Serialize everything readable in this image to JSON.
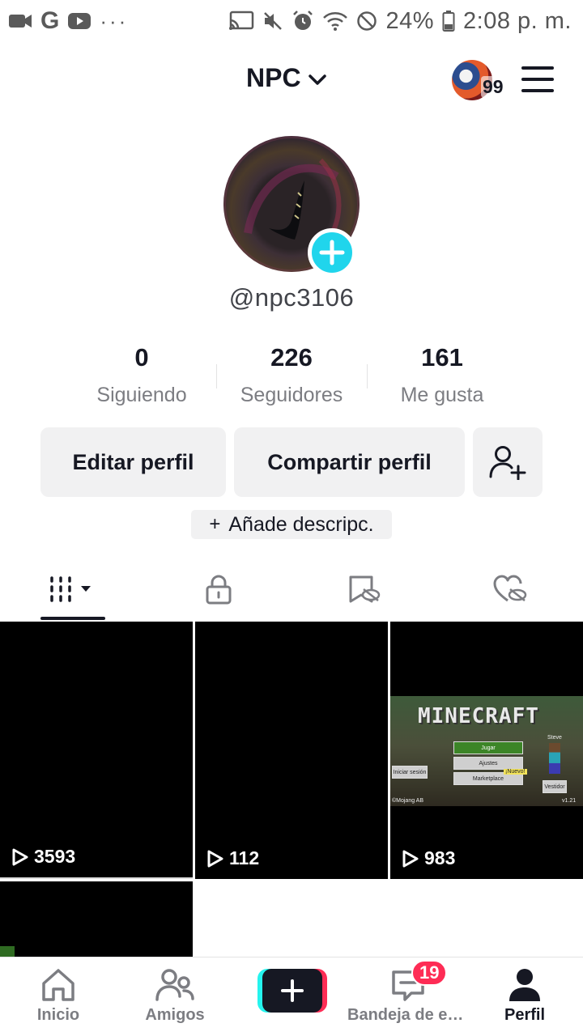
{
  "status_bar": {
    "battery": "24%",
    "time": "2:08 p. m.",
    "left_icons": [
      "video-camera-icon",
      "google-icon",
      "youtube-icon",
      "more-dots-icon"
    ],
    "right_icons": [
      "cast-icon",
      "mute-icon",
      "alarm-icon",
      "wifi-icon",
      "do-not-disturb-icon",
      "battery-icon"
    ]
  },
  "header": {
    "account_name": "NPC",
    "notification_count": "99"
  },
  "profile": {
    "username": "@npc3106",
    "stats": [
      {
        "value": "0",
        "label": "Siguiendo"
      },
      {
        "value": "226",
        "label": "Seguidores"
      },
      {
        "value": "161",
        "label": "Me gusta"
      }
    ],
    "edit_label": "Editar perfil",
    "share_label": "Compartir perfil",
    "add_description_label": "Añade descripc."
  },
  "tabs": [
    {
      "icon": "grid-icon",
      "active": true
    },
    {
      "icon": "lock-icon",
      "active": false
    },
    {
      "icon": "bookmark-hidden-icon",
      "active": false
    },
    {
      "icon": "heart-hidden-icon",
      "active": false
    }
  ],
  "videos": [
    {
      "views": "3593",
      "thumbnail": "black"
    },
    {
      "views": "112",
      "thumbnail": "black"
    },
    {
      "views": "983",
      "thumbnail": "minecraft-menu",
      "title_text": "MINECRAFT"
    }
  ],
  "minecraft_menu": {
    "play": "Jugar",
    "settings": "Ajustes",
    "marketplace": "Marketplace",
    "sign_in": "Iniciar sesión",
    "dressing": "Vestidor",
    "player": "Steve",
    "copyright": "©Mojang AB",
    "version": "v1.21",
    "new_badge": "¡Nuevo!"
  },
  "bottom_nav": [
    {
      "label": "Inicio",
      "icon": "home-icon"
    },
    {
      "label": "Amigos",
      "icon": "friends-icon"
    },
    {
      "label": "",
      "icon": "plus-icon"
    },
    {
      "label": "Bandeja de entrada",
      "icon": "inbox-icon",
      "badge": "19"
    },
    {
      "label": "Perfil",
      "icon": "profile-icon",
      "active": true
    }
  ],
  "colors": {
    "accent_cyan": "#20d5ec",
    "accent_red": "#fe2c55",
    "text_primary": "#161823",
    "text_secondary": "#7c7d82",
    "button_bg": "#f1f1f2"
  }
}
